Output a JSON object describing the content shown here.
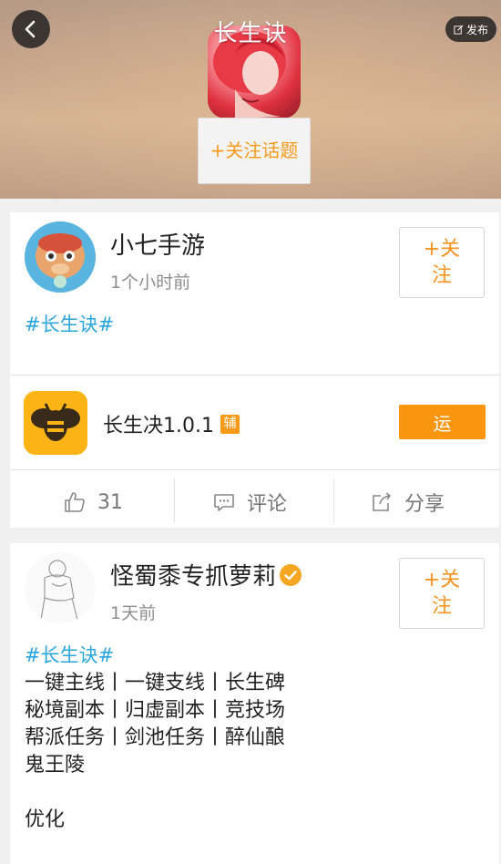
{
  "header": {
    "title": "长生诀",
    "publish_label": "发布",
    "follow_topic_label": "+关注话题"
  },
  "posts": [
    {
      "username": "小七手游",
      "time": "1个小时前",
      "follow_label": "+关注",
      "hashtag": "#长生诀#",
      "app": {
        "name": "长生决1.0.1",
        "badge": "辅",
        "run_label": "运"
      },
      "actions": {
        "likes": "31",
        "comment_label": "评论",
        "share_label": "分享"
      }
    },
    {
      "username": "怪蜀黍专抓萝莉",
      "time": "1天前",
      "follow_label": "+关注",
      "hashtag": "#长生诀#",
      "lines": [
        "一键主线丨一键支线丨长生碑",
        "秘境副本丨归虚副本丨竞技场",
        "帮派任务丨剑池任务丨醉仙酿",
        "鬼王陵",
        "",
        "优化"
      ]
    }
  ],
  "colors": {
    "accent": "#f7931e",
    "hashtag": "#2aa6df",
    "run_button": "#f9950f"
  }
}
